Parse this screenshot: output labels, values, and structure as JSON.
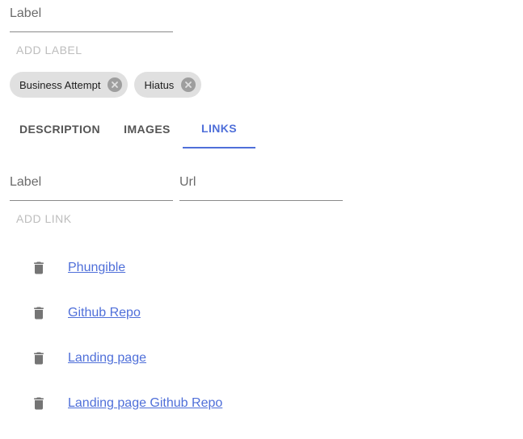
{
  "label_field": {
    "placeholder": "Label"
  },
  "add_label_button": "ADD LABEL",
  "chips": [
    {
      "label": "Business Attempt",
      "icon": "cancel-icon"
    },
    {
      "label": "Hiatus",
      "icon": "cancel-icon"
    }
  ],
  "tabs": [
    {
      "label": "DESCRIPTION",
      "active": false
    },
    {
      "label": "IMAGES",
      "active": false
    },
    {
      "label": "LINKS",
      "active": true
    }
  ],
  "link_form": {
    "label_placeholder": "Label",
    "url_placeholder": "Url",
    "add_link_button": "ADD LINK"
  },
  "links": [
    {
      "label": "Phungible",
      "icon": "trash-icon"
    },
    {
      "label": "Github Repo",
      "icon": "trash-icon"
    },
    {
      "label": "Landing page",
      "icon": "trash-icon"
    },
    {
      "label": "Landing page Github Repo",
      "icon": "trash-icon"
    }
  ],
  "colors": {
    "accent": "#4f6fd9",
    "chip_bg": "#e0e0e0",
    "disabled_text": "#bdbdbd",
    "icon_gray": "#757575"
  }
}
